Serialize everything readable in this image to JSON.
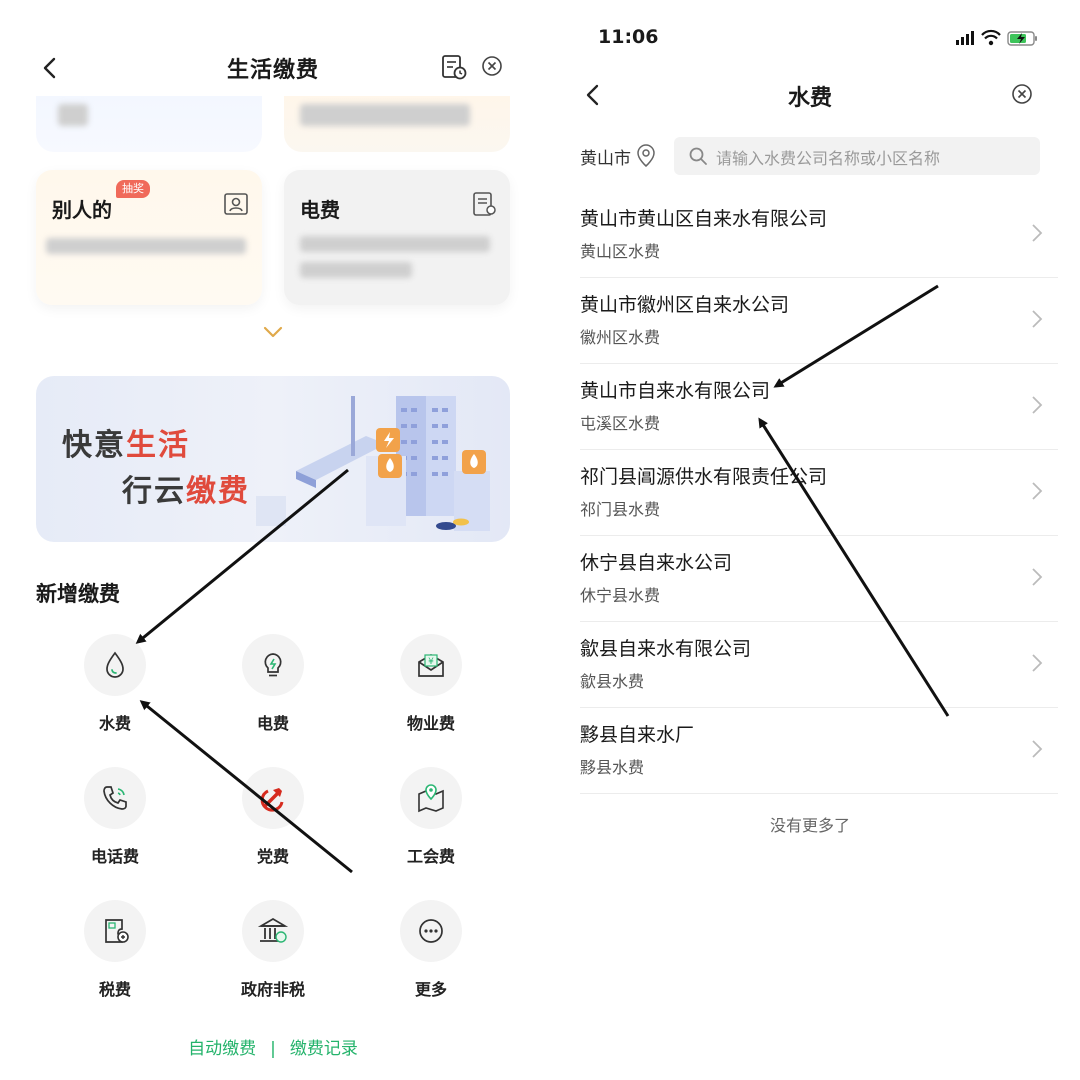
{
  "left": {
    "header": {
      "title": "生活缴费"
    },
    "cards": {
      "card_c_name": "别人的",
      "card_c_badge": "抽奖",
      "card_d_name": "电费"
    },
    "banner": {
      "line1_a": "快意",
      "line1_b": "生活",
      "line2_a": "行云",
      "line2_b": "缴费"
    },
    "section_title": "新增缴费",
    "grid": [
      {
        "label": "水费",
        "icon": "water-drop-icon"
      },
      {
        "label": "电费",
        "icon": "lightbulb-icon"
      },
      {
        "label": "物业费",
        "icon": "envelope-yen-icon"
      },
      {
        "label": "电话费",
        "icon": "phone-icon"
      },
      {
        "label": "党费",
        "icon": "party-emblem-icon"
      },
      {
        "label": "工会费",
        "icon": "map-pin-icon"
      },
      {
        "label": "税费",
        "icon": "tax-receipt-icon"
      },
      {
        "label": "政府非税",
        "icon": "government-building-icon"
      },
      {
        "label": "更多",
        "icon": "more-dots-icon"
      }
    ],
    "footer": {
      "auto_pay": "自动缴费",
      "separator": "|",
      "records": "缴费记录"
    }
  },
  "right": {
    "status": {
      "time": "11:06"
    },
    "header": {
      "title": "水费"
    },
    "city": "黄山市",
    "search": {
      "placeholder": "请输入水费公司名称或小区名称"
    },
    "companies": [
      {
        "name": "黄山市黄山区自来水有限公司",
        "sub": "黄山区水费"
      },
      {
        "name": "黄山市徽州区自来水公司",
        "sub": "徽州区水费"
      },
      {
        "name": "黄山市自来水有限公司",
        "sub": "屯溪区水费"
      },
      {
        "name": "祁门县阊源供水有限责任公司",
        "sub": "祁门县水费"
      },
      {
        "name": "休宁县自来水公司",
        "sub": "休宁县水费"
      },
      {
        "name": "歙县自来水有限公司",
        "sub": "歙县水费"
      },
      {
        "name": "黟县自来水厂",
        "sub": "黟县水费"
      }
    ],
    "no_more": "没有更多了"
  },
  "colors": {
    "accent_green": "#24b36b",
    "badge_red": "#f06a5a",
    "banner_red": "#e04a3c"
  }
}
